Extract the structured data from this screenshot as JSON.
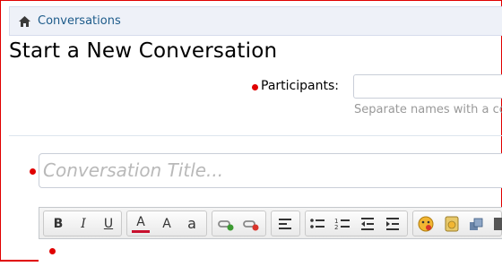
{
  "breadcrumb": {
    "link_label": "Conversations"
  },
  "page": {
    "title": "Start a New Conversation"
  },
  "participants": {
    "label": "Participants:",
    "value": "",
    "hint": "Separate names with a co"
  },
  "conversation_title": {
    "placeholder": "Conversation Title..."
  },
  "toolbar": {
    "bold": "B",
    "italic": "I",
    "underline": "U",
    "font_color": "A",
    "font_size": "A",
    "font_family": "a"
  },
  "colors": {
    "accent": "#e00000",
    "link": "#1d5b8a"
  }
}
